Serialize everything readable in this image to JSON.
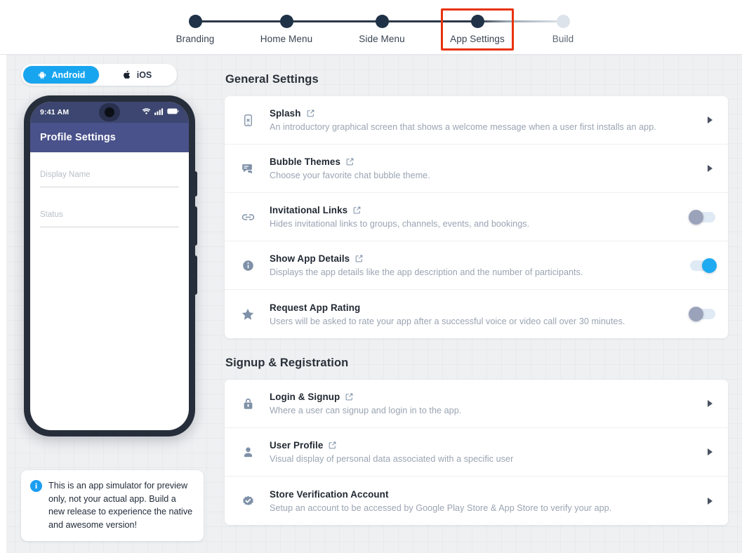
{
  "stepper": {
    "steps": [
      {
        "label": "Branding",
        "state": "done"
      },
      {
        "label": "Home Menu",
        "state": "done"
      },
      {
        "label": "Side Menu",
        "state": "done"
      },
      {
        "label": "App Settings",
        "state": "current"
      },
      {
        "label": "Build",
        "state": "upcoming"
      }
    ],
    "highlighted_step": "App Settings",
    "highlight_color": "#e8320c"
  },
  "simulator": {
    "platform_toggle": {
      "options": [
        "Android",
        "iOS"
      ],
      "selected": "Android",
      "active_color": "#18a5f0"
    },
    "phone": {
      "status_time": "9:41 AM",
      "app_bar_title": "Profile Settings",
      "fields": [
        {
          "label": "Display Name"
        },
        {
          "label": "Status"
        }
      ]
    },
    "note": "This is an app simulator for preview only, not your actual app. Build a new release to experience the native and awesome version!"
  },
  "general_settings": {
    "title": "General Settings",
    "rows": [
      {
        "icon": "phone-x-icon",
        "title": "Splash",
        "has_external_link": true,
        "desc": "An introductory graphical screen that shows a welcome message when a user first installs an app.",
        "control": "chevron"
      },
      {
        "icon": "chat-bubble-icon",
        "title": "Bubble Themes",
        "has_external_link": true,
        "desc": "Choose your favorite chat bubble theme.",
        "control": "chevron"
      },
      {
        "icon": "link-icon",
        "title": "Invitational Links",
        "has_external_link": true,
        "desc": "Hides invitational links to groups, channels, events, and bookings.",
        "control": "toggle",
        "toggle_state": "off"
      },
      {
        "icon": "info-circle-icon",
        "title": "Show App Details",
        "has_external_link": true,
        "desc": "Displays the app details like the app description and the number of participants.",
        "control": "toggle",
        "toggle_state": "on"
      },
      {
        "icon": "star-icon",
        "title": "Request App Rating",
        "has_external_link": false,
        "desc": "Users will be asked to rate your app after a successful voice or video call over 30 minutes.",
        "control": "toggle",
        "toggle_state": "off"
      }
    ]
  },
  "signup_registration": {
    "title": "Signup & Registration",
    "rows": [
      {
        "icon": "lock-icon",
        "title": "Login & Signup",
        "has_external_link": true,
        "desc": "Where a user can signup and login in to the app.",
        "control": "chevron"
      },
      {
        "icon": "user-icon",
        "title": "User Profile",
        "has_external_link": true,
        "desc": "Visual display of personal data associated with a specific user",
        "control": "chevron"
      },
      {
        "icon": "verified-badge-icon",
        "title": "Store Verification Account",
        "has_external_link": false,
        "desc": "Setup an account to be accessed by Google Play Store & App Store to verify your app.",
        "control": "chevron"
      }
    ]
  }
}
